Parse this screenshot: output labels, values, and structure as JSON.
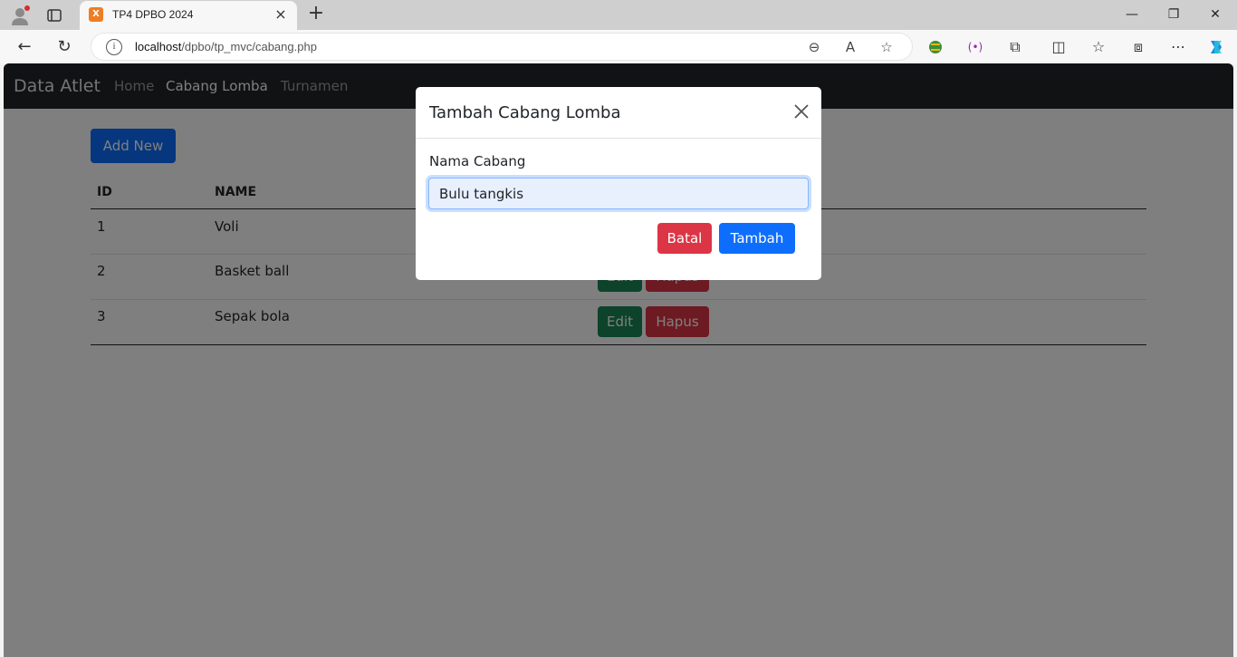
{
  "browser": {
    "tab_title": "TP4 DPBO 2024",
    "favicon_text": "X",
    "url_host": "localhost",
    "url_path": "/dpbo/tp_mvc/cabang.php"
  },
  "navbar": {
    "brand": "Data Atlet",
    "links": [
      {
        "label": "Home",
        "active": false
      },
      {
        "label": "Cabang Lomba",
        "active": true
      },
      {
        "label": "Turnamen",
        "active": false
      }
    ]
  },
  "main": {
    "add_button": "Add New",
    "table": {
      "headers": [
        "ID",
        "NAME"
      ],
      "rows": [
        {
          "id": "1",
          "name": "Voli"
        },
        {
          "id": "2",
          "name": "Basket ball"
        },
        {
          "id": "3",
          "name": "Sepak bola"
        }
      ],
      "edit_label": "Edit",
      "delete_label": "Hapus"
    }
  },
  "modal": {
    "title": "Tambah Cabang Lomba",
    "close_icon": "close-icon",
    "field_label": "Nama Cabang",
    "field_value": "Bulu tangkis",
    "cancel_label": "Batal",
    "submit_label": "Tambah"
  },
  "colors": {
    "primary": "#0d6efd",
    "danger": "#dc3545",
    "success": "#198754",
    "navbar": "#212529"
  }
}
